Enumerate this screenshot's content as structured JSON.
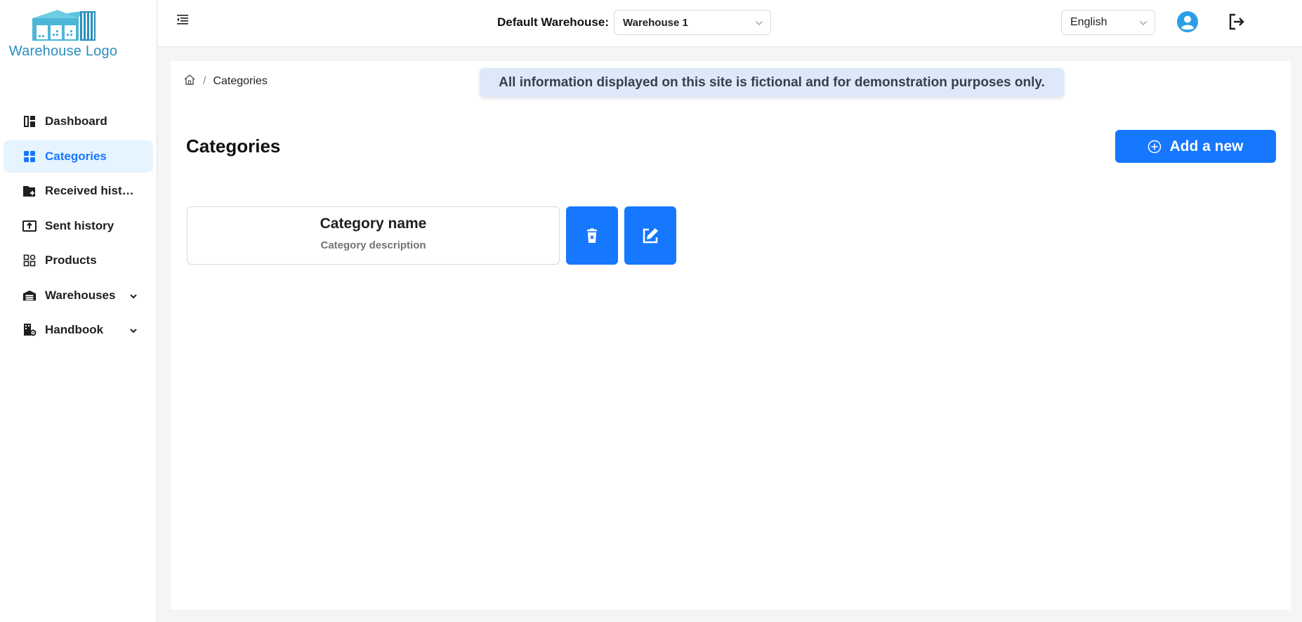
{
  "logo": {
    "text": "Warehouse Logo"
  },
  "sidebar": {
    "items": [
      {
        "label": "Dashboard",
        "icon": "dashboard-icon",
        "active": false
      },
      {
        "label": "Categories",
        "icon": "categories-icon",
        "active": true
      },
      {
        "label": "Received history",
        "icon": "received-history-icon",
        "active": false
      },
      {
        "label": "Sent history",
        "icon": "sent-history-icon",
        "active": false
      },
      {
        "label": "Products",
        "icon": "products-icon",
        "active": false
      },
      {
        "label": "Warehouses",
        "icon": "warehouse-icon",
        "active": false,
        "expandable": true
      },
      {
        "label": "Handbook",
        "icon": "handbook-icon",
        "active": false,
        "expandable": true
      }
    ]
  },
  "header": {
    "warehouse_label": "Default Warehouse:",
    "warehouse_value": "Warehouse 1",
    "language_value": "English"
  },
  "breadcrumb": {
    "current": "Categories"
  },
  "notice": "All information displayed on this site is fictional and for demonstration purposes only.",
  "page": {
    "title": "Categories",
    "add_button": "Add a new"
  },
  "category_card": {
    "name": "Category name",
    "description": "Category description"
  },
  "colors": {
    "primary": "#1677ff",
    "active_bg": "#e6f4ff",
    "notice_bg": "#dde9fa",
    "logo": "#2a8fbd"
  }
}
